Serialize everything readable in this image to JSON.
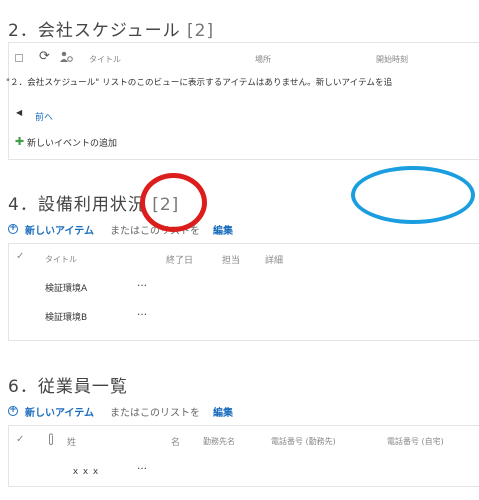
{
  "sections": {
    "schedule": {
      "title": "2．会社スケジュール",
      "count": "[2]",
      "columns": {
        "title": "タイトル",
        "location": "場所",
        "start": "開始時刻"
      },
      "empty_message": "\"２．会社スケジュール\" リストのこのビューに表示するアイテムはありません。新しいアイテムを追",
      "prev_label": "前へ",
      "add_event_label": "新しいイベントの追加"
    },
    "equipment": {
      "title": "4．設備利用状況",
      "count": "[2]",
      "new_item_label": "新しいアイテム",
      "new_item_middle": "またはこのリストを",
      "edit_label": "編集",
      "columns": {
        "title": "タイトル",
        "end": "終了日",
        "owner": "担当",
        "detail": "詳細"
      },
      "rows": [
        {
          "title": "検証環境A",
          "menu": "…"
        },
        {
          "title": "検証環境B",
          "menu": "…"
        }
      ]
    },
    "employees": {
      "title": "6．従業員一覧",
      "new_item_label": "新しいアイテム",
      "new_item_middle": "またはこのリストを",
      "edit_label": "編集",
      "columns": {
        "last_name": "姓",
        "first_name": "名",
        "office": "勤務先名",
        "work_phone": "電話番号 (勤務先)",
        "home_phone": "電話番号 (自宅)"
      },
      "rows": [
        {
          "last_name": "ｘｘｘ",
          "menu": "…"
        }
      ]
    }
  },
  "colors": {
    "link": "#1a6dbd",
    "annotation_red": "#dd1c1c",
    "annotation_blue": "#1a9ee0"
  },
  "icons": [
    "checkbox-icon",
    "refresh-icon",
    "attachment-people-icon",
    "triangle-left-icon",
    "green-plus-icon",
    "plus-circle-icon",
    "checkmark-icon",
    "paperclip-icon"
  ]
}
